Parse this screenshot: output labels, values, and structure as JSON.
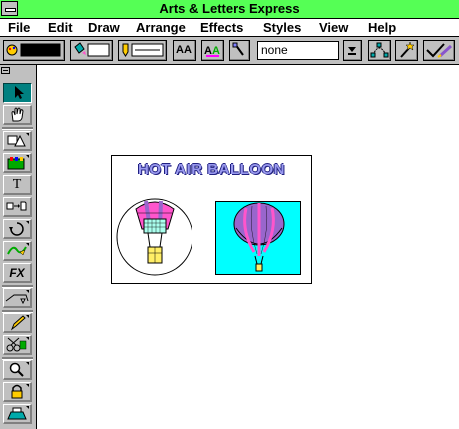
{
  "window": {
    "title": "Arts & Letters Express"
  },
  "menu": [
    "File",
    "Edit",
    "Draw",
    "Arrange",
    "Effects",
    "Styles",
    "View",
    "Help"
  ],
  "toolbar": {
    "style_name_value": "none",
    "font_button_label": "AA"
  },
  "tools": {
    "text_label": "T",
    "fx_label": "FX"
  },
  "canvas": {
    "card_title": "HOT AIR BALLOON"
  },
  "colors": {
    "titlebar": "#55ff55",
    "panel": "#c0c0c0",
    "active_tool": "#008080",
    "balloon_stripe_pink": "#ff55cc",
    "balloon_stripe_purple": "#9966cc",
    "photo_bg": "#00ffff"
  }
}
